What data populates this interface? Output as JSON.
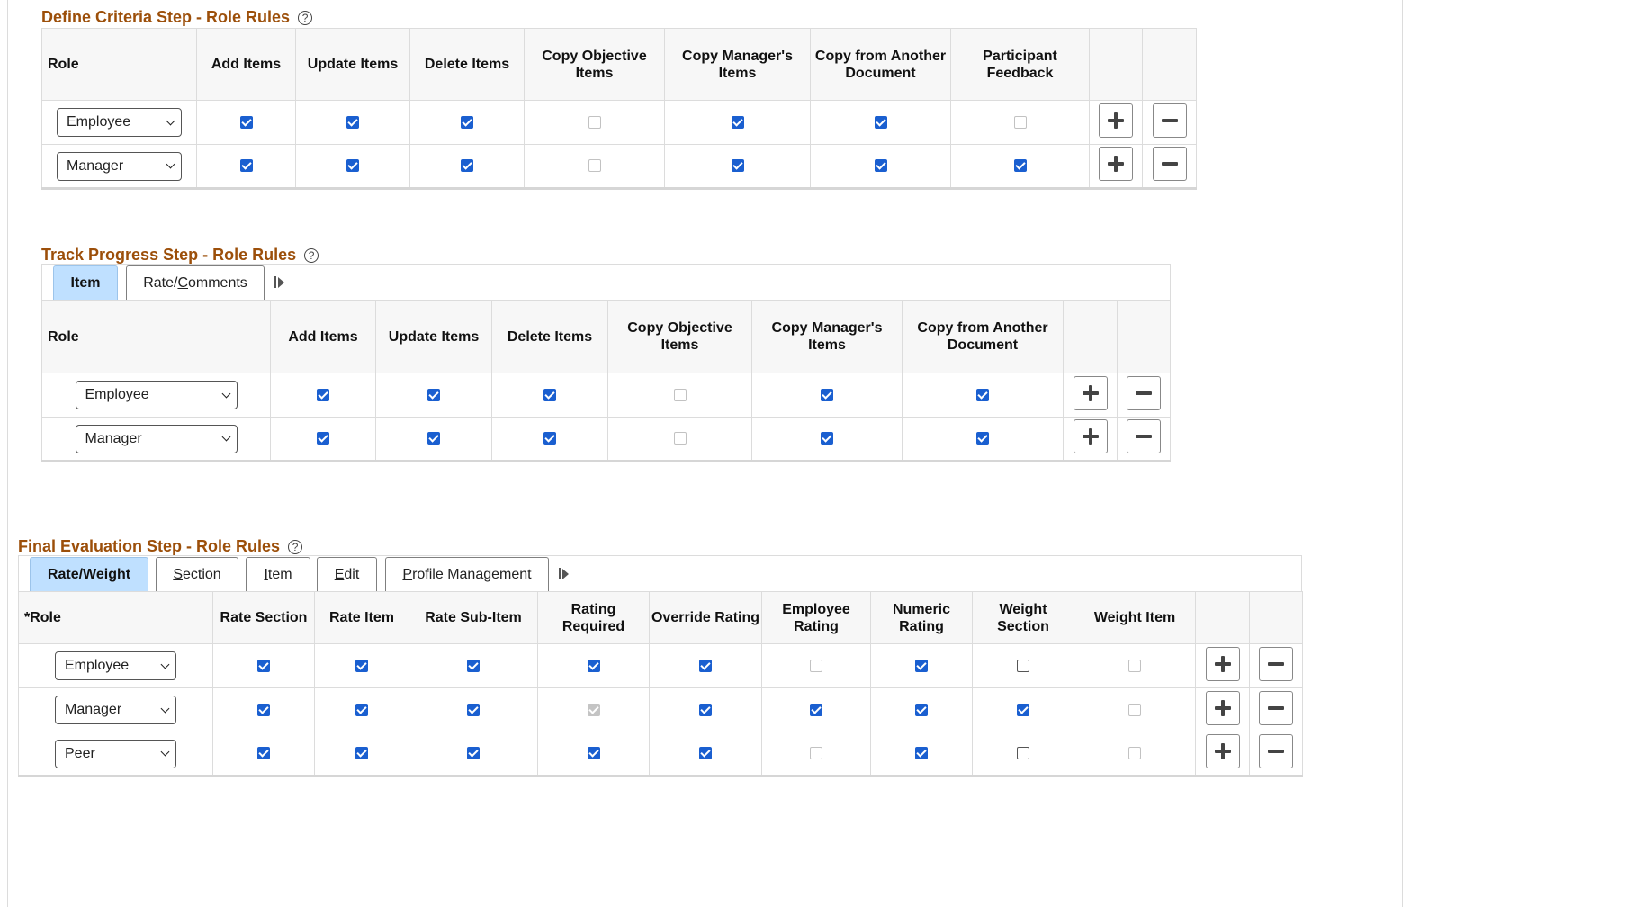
{
  "define_criteria": {
    "title": "Define Criteria Step - Role Rules",
    "help_icon": "question-circle-icon",
    "columns": [
      "Role",
      "Add Items",
      "Update Items",
      "Delete Items",
      "Copy Objective Items",
      "Copy Manager's Items",
      "Copy from Another Document",
      "Participant Feedback"
    ],
    "rows": [
      {
        "role": "Employee",
        "checks": [
          "on",
          "on",
          "on",
          "off",
          "on",
          "on",
          "off"
        ]
      },
      {
        "role": "Manager",
        "checks": [
          "on",
          "on",
          "on",
          "off",
          "on",
          "on",
          "on"
        ]
      }
    ]
  },
  "track_progress": {
    "title": "Track Progress Step - Role Rules",
    "help_icon": "question-circle-icon",
    "tabs": [
      {
        "pre": "",
        "key": "",
        "post": "Item",
        "active": true
      },
      {
        "pre": "Rate/",
        "key": "C",
        "post": "omments",
        "active": false
      }
    ],
    "columns": [
      "Role",
      "Add Items",
      "Update Items",
      "Delete Items",
      "Copy Objective Items",
      "Copy Manager's Items",
      "Copy from Another Document"
    ],
    "rows": [
      {
        "role": "Employee",
        "checks": [
          "on",
          "on",
          "on",
          "off",
          "on",
          "on"
        ]
      },
      {
        "role": "Manager",
        "checks": [
          "on",
          "on",
          "on",
          "off",
          "on",
          "on"
        ]
      }
    ]
  },
  "final_evaluation": {
    "title": "Final Evaluation Step - Role Rules",
    "help_icon": "question-circle-icon",
    "tabs": [
      {
        "pre": "",
        "key": "",
        "post": "Rate/Weight",
        "active": true
      },
      {
        "pre": "",
        "key": "S",
        "post": "ection",
        "active": false
      },
      {
        "pre": "",
        "key": "I",
        "post": "tem",
        "active": false
      },
      {
        "pre": "",
        "key": "E",
        "post": "dit",
        "active": false
      },
      {
        "pre": "",
        "key": "P",
        "post": "rofile Management",
        "active": false
      }
    ],
    "columns": [
      "*Role",
      "Rate Section",
      "Rate Item",
      "Rate Sub-Item",
      "Rating Required",
      "Override Rating",
      "Employee Rating",
      "Numeric Rating",
      "Weight Section",
      "Weight Item"
    ],
    "rows": [
      {
        "role": "Employee",
        "checks": [
          "on",
          "on",
          "on",
          "on",
          "on",
          "off",
          "on",
          "off-dark",
          "off"
        ]
      },
      {
        "role": "Manager",
        "checks": [
          "on",
          "on",
          "on",
          "disabled",
          "on",
          "on",
          "on",
          "on",
          "off"
        ]
      },
      {
        "role": "Peer",
        "checks": [
          "on",
          "on",
          "on",
          "on",
          "on",
          "off",
          "on",
          "off-dark",
          "off"
        ]
      }
    ]
  },
  "icons": {
    "add": "plus-icon",
    "delete": "minus-icon",
    "dropdown": "chevron-down-icon",
    "show_all_columns": "show-all-columns-icon"
  },
  "colors": {
    "section_title": "#9c4f0a",
    "checkbox_checked": "#1a5fd0",
    "active_tab": "#bfe0ff"
  }
}
